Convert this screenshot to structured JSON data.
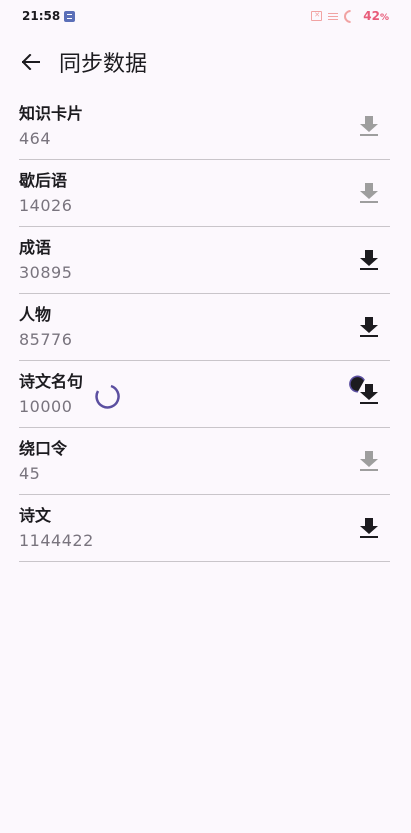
{
  "status_bar": {
    "time": "21:58",
    "battery": "42",
    "battery_unit": "%",
    "icons": [
      "notification-icon",
      "sim-off-icon",
      "wifi-icon",
      "battery-ring-icon"
    ]
  },
  "app_bar": {
    "back_icon": "arrow-left-icon",
    "title": "同步数据"
  },
  "items": [
    {
      "title": "知识卡片",
      "count": "464",
      "state": "disabled"
    },
    {
      "title": "歇后语",
      "count": "14026",
      "state": "disabled"
    },
    {
      "title": "成语",
      "count": "30895",
      "state": "enabled"
    },
    {
      "title": "人物",
      "count": "85776",
      "state": "enabled"
    },
    {
      "title": "诗文名句",
      "count": "10000",
      "state": "loading"
    },
    {
      "title": "绕口令",
      "count": "45",
      "state": "disabled"
    },
    {
      "title": "诗文",
      "count": "1144422",
      "state": "enabled"
    }
  ],
  "colors": {
    "background": "#FCF8FD",
    "accent": "#5B4FA0",
    "divider": "#C9C5CA",
    "disabled_icon": "#9E9E9E",
    "battery": "#E85C7A"
  }
}
